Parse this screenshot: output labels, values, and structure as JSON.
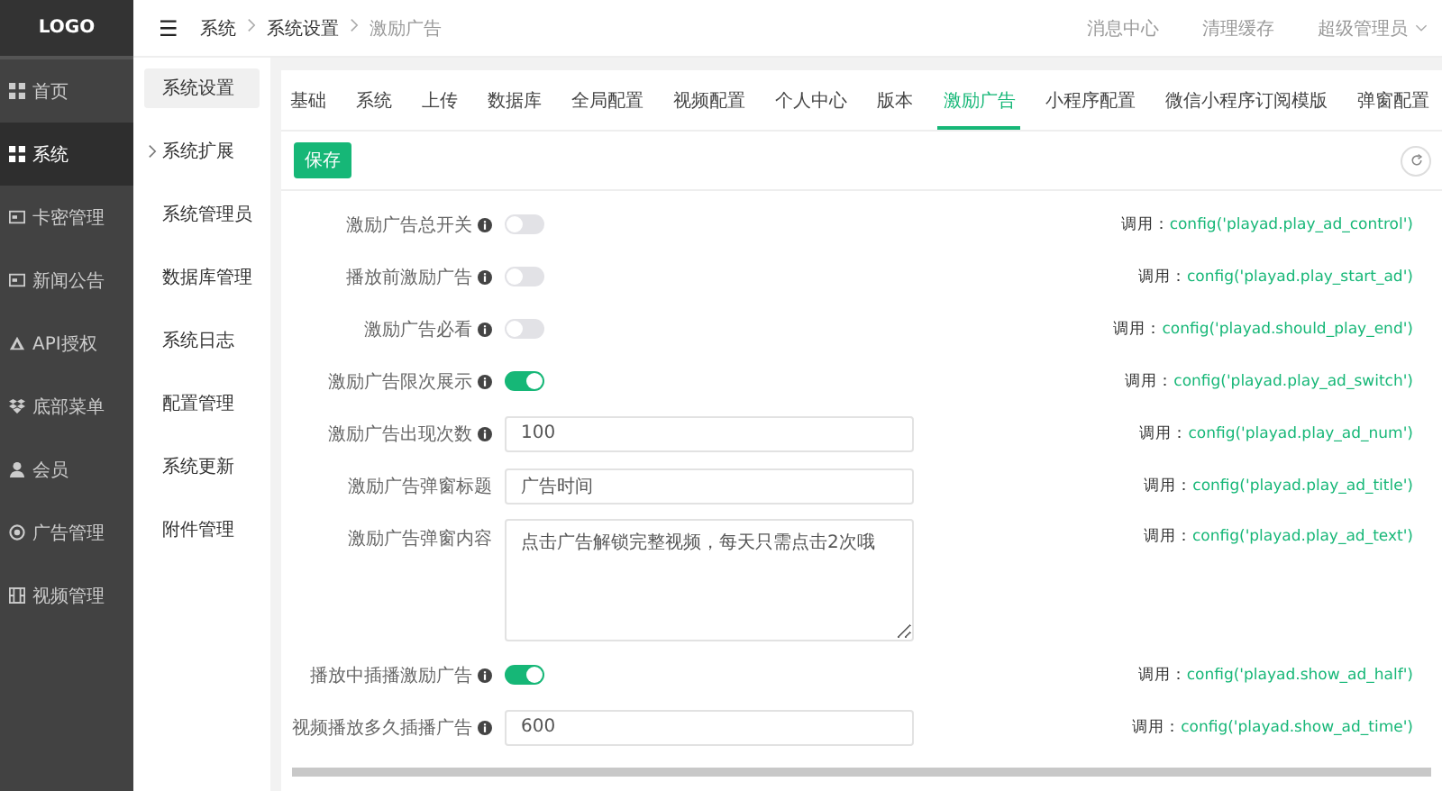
{
  "logo": "LOGO",
  "sidebar": {
    "items": [
      {
        "label": "首页",
        "kind": "grid",
        "selected": false
      },
      {
        "label": "系统",
        "kind": "grid",
        "selected": true
      },
      {
        "label": "卡密管理",
        "kind": "card",
        "selected": false
      },
      {
        "label": "新闻公告",
        "kind": "card",
        "selected": false
      },
      {
        "label": "API授权",
        "kind": "triangle",
        "selected": false
      },
      {
        "label": "底部菜单",
        "kind": "boxes",
        "selected": false
      },
      {
        "label": "会员",
        "kind": "user",
        "selected": false
      },
      {
        "label": "广告管理",
        "kind": "target",
        "selected": false
      },
      {
        "label": "视频管理",
        "kind": "film",
        "selected": false
      }
    ]
  },
  "header": {
    "menu_icon": "☰",
    "breadcrumb": [
      "系统",
      "系统设置",
      "激励广告"
    ],
    "links": [
      "消息中心",
      "清理缓存"
    ],
    "user": "超级管理员"
  },
  "subnav": {
    "items": [
      {
        "label": "系统设置",
        "selected": true,
        "expandable": false
      },
      {
        "label": "系统扩展",
        "selected": false,
        "expandable": true
      },
      {
        "label": "系统管理员",
        "selected": false,
        "expandable": false
      },
      {
        "label": "数据库管理",
        "selected": false,
        "expandable": false
      },
      {
        "label": "系统日志",
        "selected": false,
        "expandable": false
      },
      {
        "label": "配置管理",
        "selected": false,
        "expandable": false
      },
      {
        "label": "系统更新",
        "selected": false,
        "expandable": false
      },
      {
        "label": "附件管理",
        "selected": false,
        "expandable": false
      }
    ]
  },
  "tabs": [
    {
      "label": "基础",
      "selected": false
    },
    {
      "label": "系统",
      "selected": false
    },
    {
      "label": "上传",
      "selected": false
    },
    {
      "label": "数据库",
      "selected": false
    },
    {
      "label": "全局配置",
      "selected": false
    },
    {
      "label": "视频配置",
      "selected": false
    },
    {
      "label": "个人中心",
      "selected": false
    },
    {
      "label": "版本",
      "selected": false
    },
    {
      "label": "激励广告",
      "selected": true
    },
    {
      "label": "小程序配置",
      "selected": false
    },
    {
      "label": "微信小程序订阅模版",
      "selected": false
    },
    {
      "label": "弹窗配置",
      "selected": false
    }
  ],
  "save_button": "保存",
  "form": [
    {
      "kind": "switch",
      "label": "激励广告总开关",
      "info": true,
      "on": false,
      "call_label": "调用：",
      "call": "config('playad.play_ad_control')"
    },
    {
      "kind": "switch",
      "label": "播放前激励广告",
      "info": true,
      "on": false,
      "call_label": "调用：",
      "call": "config('playad.play_start_ad')"
    },
    {
      "kind": "switch",
      "label": "激励广告必看",
      "info": true,
      "on": false,
      "call_label": "调用：",
      "call": "config('playad.should_play_end')"
    },
    {
      "kind": "switch",
      "label": "激励广告限次展示",
      "info": true,
      "on": true,
      "call_label": "调用：",
      "call": "config('playad.play_ad_switch')"
    },
    {
      "kind": "input",
      "label": "激励广告出现次数",
      "info": true,
      "value": "100",
      "call_label": "调用：",
      "call": "config('playad.play_ad_num')"
    },
    {
      "kind": "input",
      "label": "激励广告弹窗标题",
      "info": false,
      "value": "广告时间",
      "call_label": "调用：",
      "call": "config('playad.play_ad_title')"
    },
    {
      "kind": "textarea",
      "label": "激励广告弹窗内容",
      "info": false,
      "value": "点击广告解锁完整视频，每天只需点击2次哦",
      "call_label": "调用：",
      "call": "config('playad.play_ad_text')"
    },
    {
      "kind": "switch",
      "label": "播放中插播激励广告",
      "info": true,
      "on": true,
      "call_label": "调用：",
      "call": "config('playad.show_ad_half')"
    },
    {
      "kind": "input",
      "label": "视频播放多久插播广告",
      "info": true,
      "value": "600",
      "call_label": "调用：",
      "call": "config('playad.show_ad_time')"
    }
  ]
}
